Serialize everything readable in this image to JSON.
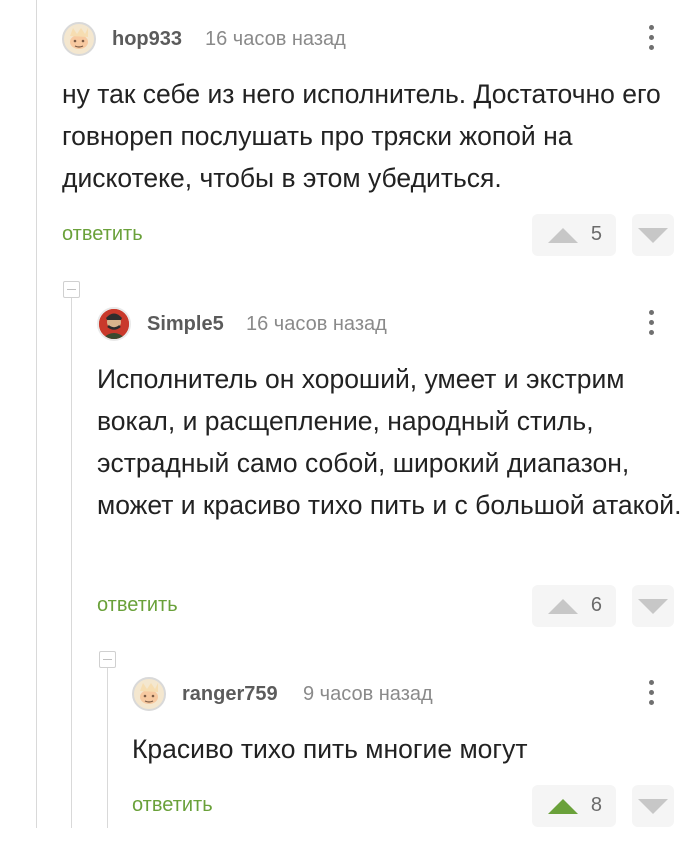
{
  "comments": [
    {
      "username": "hop933",
      "time": "16 часов назад",
      "text": "ну так себе из него исполнитель. Достаточно его говнореп послушать про тряски жопой на дискотеке, чтобы в этом убедиться.",
      "reply_label": "ответить",
      "votes": "5",
      "avatar": "default-avatar-icon",
      "upvoted": false
    },
    {
      "username": "Simple5",
      "time": "16 часов назад",
      "text": "Исполнитель он хороший, умеет и экстрим вокал, и расщепление, народный стиль, эстрадный само собой, широкий диапазон, может и красиво тихо пить и с большой атакой.",
      "reply_label": "ответить",
      "votes": "6",
      "avatar": "user-photo-avatar",
      "upvoted": false
    },
    {
      "username": "ranger759",
      "time": "9 часов назад",
      "text": "Красиво тихо пить многие могут",
      "reply_label": "ответить",
      "votes": "8",
      "avatar": "default-avatar-icon",
      "upvoted": true
    }
  ],
  "colors": {
    "accent_green": "#6aa13a",
    "vote_gray": "#c7c7c7",
    "thread_line": "#d9d9d9"
  }
}
